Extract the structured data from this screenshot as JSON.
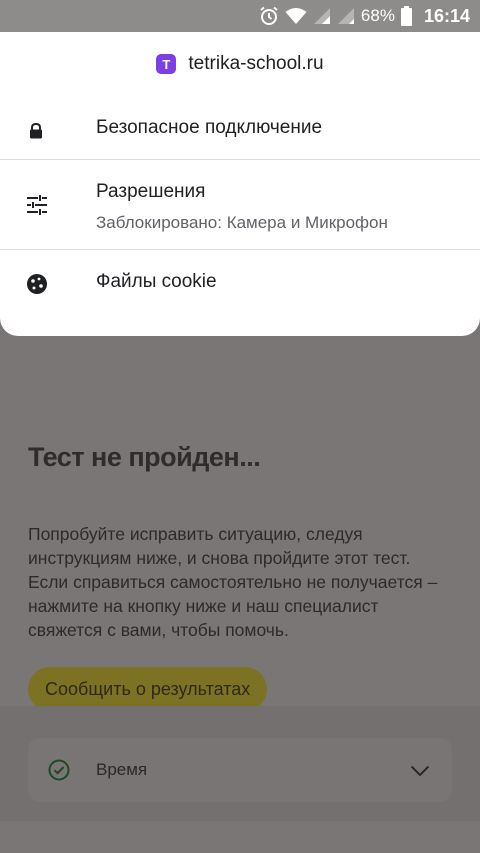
{
  "status_bar": {
    "battery": "68%",
    "time": "16:14",
    "icons": [
      "alarm-icon",
      "wifi-icon",
      "signal-icon",
      "signal-icon",
      "battery-icon"
    ]
  },
  "site_info": {
    "favicon_letter": "T",
    "url": "tetrika-school.ru",
    "items": [
      {
        "icon": "lock-icon",
        "title": "Безопасное подключение"
      },
      {
        "icon": "sliders-icon",
        "title": "Разрешения",
        "subtitle": "Заблокировано: Камера и Микрофон"
      },
      {
        "icon": "cookie-icon",
        "title": "Файлы cookie"
      }
    ]
  },
  "page": {
    "title": "Тест не пройден...",
    "text": "Попробуйте исправить ситуацию, следуя\nинструкциям ниже, и снова пройдите этот тест.\nЕсли справиться самостоятельно не получается –\nнажмите на кнопку ниже и наш специалист\nсвяжется с вами, чтобы помочь.",
    "report_button": "Сообщить о результатах",
    "accordion": {
      "label": "Время"
    }
  },
  "colors": {
    "favicon": "#7d3ee6",
    "accent_button": "#f4da2a",
    "check_green": "#1e9e3a"
  }
}
